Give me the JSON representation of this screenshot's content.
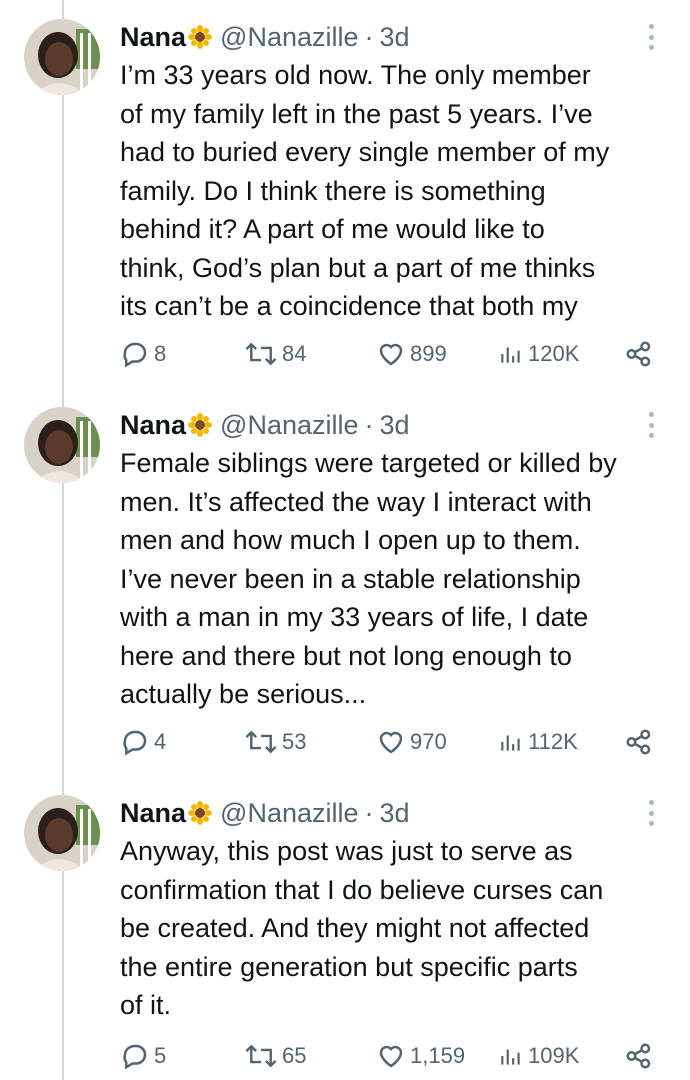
{
  "tweets": [
    {
      "name": "Nana",
      "handle": "@Nanazille",
      "separator": "·",
      "time": "3d",
      "lines": [
        "I’m 33 years old now. The only member",
        "of my family left in the past 5 years. I’ve",
        "had to buried every single member of my",
        "family. Do I think there is something",
        "behind it? A part of me would like to",
        "think, God’s plan but a part of me thinks",
        "its can’t be a coincidence that both my"
      ],
      "replies": "8",
      "retweets": "84",
      "likes": "899",
      "views": "120K"
    },
    {
      "name": "Nana",
      "handle": "@Nanazille",
      "separator": "·",
      "time": "3d",
      "lines": [
        "Female siblings were targeted or killed by",
        "men.  It’s affected the way I interact with",
        "men and how much I open up to them.",
        "I’ve never been in a stable relationship",
        "with a man in my 33 years of life, I date",
        "here and there but not long enough to",
        "actually be serious..."
      ],
      "replies": "4",
      "retweets": "53",
      "likes": "970",
      "views": "112K"
    },
    {
      "name": "Nana",
      "handle": "@Nanazille",
      "separator": "·",
      "time": "3d",
      "lines": [
        "Anyway, this post was just to serve as",
        "confirmation that I do believe curses can",
        "be created. And they might not affected",
        "the entire generation but specific parts",
        "of it."
      ],
      "replies": "5",
      "retweets": "65",
      "likes": "1,159",
      "views": "109K"
    }
  ],
  "icons": {
    "reply": "reply-icon",
    "retweet": "retweet-icon",
    "like": "like-icon",
    "views": "views-icon",
    "share": "share-icon",
    "more": "more-icon",
    "name_emoji": "sunflower-icon"
  },
  "colors": {
    "text": "#0f1419",
    "secondary": "#536471",
    "thread_line": "#cfd9de",
    "background": "#ffffff"
  }
}
